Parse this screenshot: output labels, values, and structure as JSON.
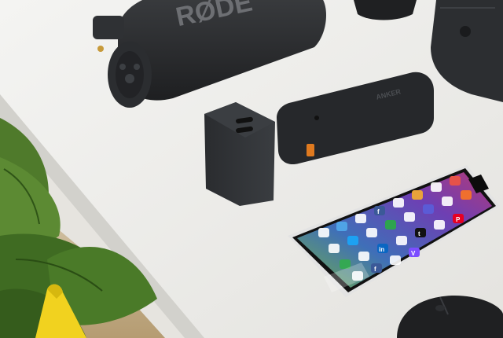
{
  "photo": {
    "microphone": {
      "brand_text": "RØDE"
    },
    "power_bank": {
      "brand_text": "ANKER"
    },
    "phone": {
      "home_screen_app_labels": [
        "f",
        "f",
        "t",
        "in",
        "P",
        "V"
      ]
    }
  }
}
